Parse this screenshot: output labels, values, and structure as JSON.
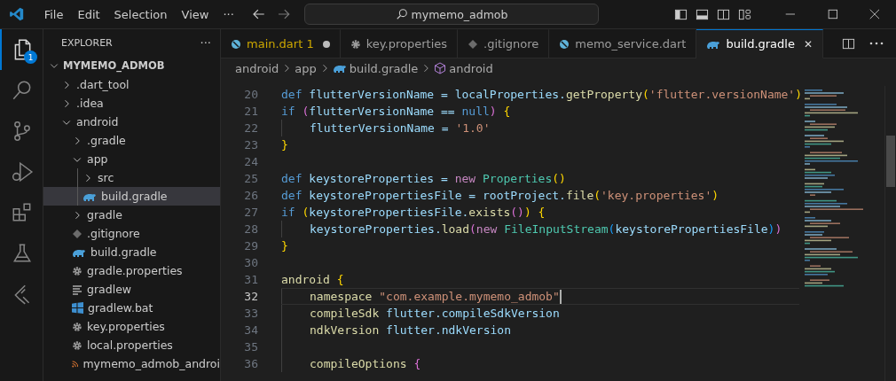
{
  "menu": [
    "File",
    "Edit",
    "Selection",
    "View",
    "···"
  ],
  "search": {
    "value": "mymemo_admob"
  },
  "activity": [
    {
      "kind": "explorer",
      "selected": true,
      "badge": "1"
    },
    {
      "kind": "search",
      "selected": false
    },
    {
      "kind": "git",
      "selected": false
    },
    {
      "kind": "debug",
      "selected": false
    },
    {
      "kind": "extensions",
      "selected": false
    },
    {
      "kind": "testing",
      "selected": false
    },
    {
      "kind": "flutter",
      "selected": false
    }
  ],
  "explorer": {
    "title": "EXPLORER",
    "more": "···",
    "root": "MYMEMO_ADMOB",
    "tree": [
      {
        "name": ".dart_tool",
        "kind": "folder",
        "expanded": false,
        "selected": false
      },
      {
        "name": ".idea",
        "kind": "folder",
        "expanded": false,
        "selected": false
      },
      {
        "name": "android",
        "kind": "folder",
        "expanded": true,
        "selected": false,
        "children": [
          {
            "name": ".gradle",
            "kind": "folder",
            "expanded": false,
            "selected": false
          },
          {
            "name": "app",
            "kind": "folder",
            "expanded": true,
            "selected": false,
            "children": [
              {
                "name": "src",
                "kind": "folder",
                "expanded": false,
                "selected": false
              },
              {
                "name": "build.gradle",
                "kind": "gradle",
                "selected": true
              }
            ]
          },
          {
            "name": "gradle",
            "kind": "folder",
            "expanded": false,
            "selected": false
          },
          {
            "name": ".gitignore",
            "kind": "git",
            "selected": false
          },
          {
            "name": "build.gradle",
            "kind": "gradle",
            "selected": false
          },
          {
            "name": "gradle.properties",
            "kind": "gear",
            "selected": false
          },
          {
            "name": "gradlew",
            "kind": "lines",
            "selected": false
          },
          {
            "name": "gradlew.bat",
            "kind": "windows",
            "selected": false
          },
          {
            "name": "key.properties",
            "kind": "gear",
            "selected": false
          },
          {
            "name": "local.properties",
            "kind": "gear",
            "selected": false
          },
          {
            "name": "mymemo_admob_androi",
            "kind": "feed",
            "selected": false
          }
        ]
      }
    ]
  },
  "tabs": [
    {
      "label": "main.dart",
      "kind": "dart",
      "problems": "1",
      "modified": true,
      "selected": false
    },
    {
      "label": "key.properties",
      "kind": "gear",
      "modified": false,
      "selected": false
    },
    {
      "label": ".gitignore",
      "kind": "git",
      "modified": false,
      "selected": false
    },
    {
      "label": "memo_service.dart",
      "kind": "dart",
      "modified": false,
      "selected": false
    },
    {
      "label": "build.gradle",
      "kind": "gradle",
      "modified": false,
      "selected": true,
      "close": "✕"
    }
  ],
  "breadcrumb": [
    {
      "label": "android",
      "kind": "folder"
    },
    {
      "label": "app",
      "kind": "folder"
    },
    {
      "label": "build.gradle",
      "kind": "gradle"
    },
    {
      "label": "android",
      "kind": "block"
    }
  ],
  "code": [
    {
      "number": "20",
      "current": false,
      "indent": false,
      "tokens": [
        {
          "text": "def ",
          "kind": "kw"
        },
        {
          "text": "flutterVersionName = localProperties.",
          "kind": "var"
        },
        {
          "text": "getProperty",
          "kind": "fn"
        },
        {
          "text": "(",
          "kind": "p1"
        },
        {
          "text": "'flutter.versionName'",
          "kind": "str"
        },
        {
          "text": ")",
          "kind": "p1"
        }
      ]
    },
    {
      "number": "21",
      "current": false,
      "indent": false,
      "tokens": [
        {
          "text": "if ",
          "kind": "kw"
        },
        {
          "text": "(",
          "kind": "p2"
        },
        {
          "text": "flutterVersionName == ",
          "kind": "var"
        },
        {
          "text": "null",
          "kind": "kw"
        },
        {
          "text": ") ",
          "kind": "p2"
        },
        {
          "text": "{",
          "kind": "p1"
        }
      ]
    },
    {
      "number": "22",
      "current": false,
      "indent": true,
      "tokens": [
        {
          "text": "flutterVersionName = ",
          "kind": "var"
        },
        {
          "text": "'1.0'",
          "kind": "str"
        }
      ]
    },
    {
      "number": "23",
      "current": false,
      "indent": false,
      "tokens": [
        {
          "text": "}",
          "kind": "p1"
        }
      ]
    },
    {
      "number": "24",
      "current": false,
      "indent": false
    },
    {
      "number": "25",
      "current": false,
      "indent": false,
      "tokens": [
        {
          "text": "def ",
          "kind": "kw"
        },
        {
          "text": "keystoreProperties = ",
          "kind": "var"
        },
        {
          "text": "new ",
          "kind": "kw2"
        },
        {
          "text": "Properties",
          "kind": "cls"
        },
        {
          "text": "()",
          "kind": "p1"
        }
      ]
    },
    {
      "number": "26",
      "current": false,
      "indent": false,
      "tokens": [
        {
          "text": "def ",
          "kind": "kw"
        },
        {
          "text": "keystorePropertiesFile = rootProject.",
          "kind": "var"
        },
        {
          "text": "file",
          "kind": "fn"
        },
        {
          "text": "(",
          "kind": "p1"
        },
        {
          "text": "'key.properties'",
          "kind": "str"
        },
        {
          "text": ")",
          "kind": "p1"
        }
      ]
    },
    {
      "number": "27",
      "current": false,
      "indent": false,
      "tokens": [
        {
          "text": "if ",
          "kind": "kw"
        },
        {
          "text": "(",
          "kind": "p1"
        },
        {
          "text": "keystorePropertiesFile.",
          "kind": "var"
        },
        {
          "text": "exists",
          "kind": "fn"
        },
        {
          "text": "()",
          "kind": "p2"
        },
        {
          "text": ") ",
          "kind": "p1"
        },
        {
          "text": "{",
          "kind": "p1"
        }
      ]
    },
    {
      "number": "28",
      "current": false,
      "indent": true,
      "tokens": [
        {
          "text": "keystoreProperties.",
          "kind": "var"
        },
        {
          "text": "load",
          "kind": "fn"
        },
        {
          "text": "(",
          "kind": "p2"
        },
        {
          "text": "new ",
          "kind": "kw2"
        },
        {
          "text": "FileInputStream",
          "kind": "cls"
        },
        {
          "text": "(",
          "kind": "p3"
        },
        {
          "text": "keystorePropertiesFile",
          "kind": "var"
        },
        {
          "text": ")",
          "kind": "p3"
        },
        {
          "text": ")",
          "kind": "p2"
        }
      ]
    },
    {
      "number": "29",
      "current": false,
      "indent": false,
      "tokens": [
        {
          "text": "}",
          "kind": "p1"
        }
      ]
    },
    {
      "number": "30",
      "current": false,
      "indent": false
    },
    {
      "number": "31",
      "current": false,
      "indent": false,
      "tokens": [
        {
          "text": "android ",
          "kind": "fn"
        },
        {
          "text": "{",
          "kind": "p1"
        }
      ]
    },
    {
      "number": "32",
      "current": true,
      "indent": true,
      "tokens": [
        {
          "text": "namespace ",
          "kind": "fn"
        },
        {
          "text": "\"com.example.mymemo_admob\"",
          "kind": "str"
        }
      ]
    },
    {
      "number": "33",
      "current": false,
      "indent": true,
      "tokens": [
        {
          "text": "compileSdk ",
          "kind": "fn"
        },
        {
          "text": "flutter.compileSdkVersion",
          "kind": "var"
        }
      ]
    },
    {
      "number": "34",
      "current": false,
      "indent": true,
      "tokens": [
        {
          "text": "ndkVersion ",
          "kind": "fn"
        },
        {
          "text": "flutter.ndkVersion",
          "kind": "var"
        }
      ]
    },
    {
      "number": "35",
      "current": false,
      "indent": true
    },
    {
      "number": "36",
      "current": false,
      "indent": true,
      "tokens": [
        {
          "text": "compileOptions ",
          "kind": "fn"
        },
        {
          "text": "{",
          "kind": "p2"
        }
      ]
    }
  ]
}
